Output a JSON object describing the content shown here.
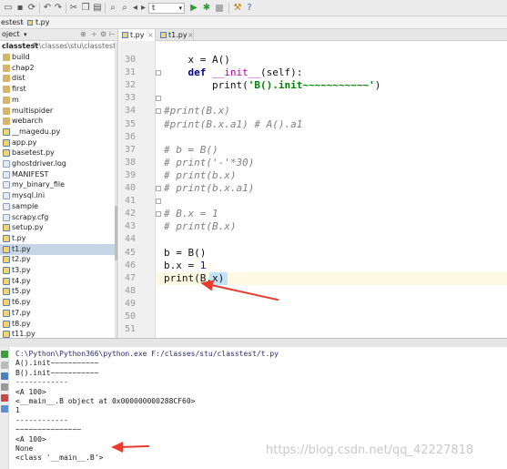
{
  "toolbar": {
    "run_config": "t"
  },
  "navbar": {
    "crumbs": [
      "estest",
      "t.py"
    ]
  },
  "project": {
    "header": "oject",
    "root_label": "classtest",
    "root_path": "F:\\classes\\stu\\classtest",
    "items": [
      {
        "label": "build",
        "kind": "folder"
      },
      {
        "label": "chap2",
        "kind": "folder"
      },
      {
        "label": "dist",
        "kind": "folder"
      },
      {
        "label": "first",
        "kind": "folder"
      },
      {
        "label": "m",
        "kind": "folder"
      },
      {
        "label": "multispider",
        "kind": "folder"
      },
      {
        "label": "webarch",
        "kind": "folder"
      },
      {
        "label": "__magedu.py",
        "kind": "py"
      },
      {
        "label": "app.py",
        "kind": "py"
      },
      {
        "label": "basetest.py",
        "kind": "py"
      },
      {
        "label": "ghostdriver.log",
        "kind": "file"
      },
      {
        "label": "MANIFEST",
        "kind": "file"
      },
      {
        "label": "my_binary_file",
        "kind": "file"
      },
      {
        "label": "mysql.ini",
        "kind": "file"
      },
      {
        "label": "sample",
        "kind": "file"
      },
      {
        "label": "scrapy.cfg",
        "kind": "file"
      },
      {
        "label": "setup.py",
        "kind": "py"
      },
      {
        "label": "t.py",
        "kind": "py"
      },
      {
        "label": "t1.py",
        "kind": "py"
      },
      {
        "label": "t2.py",
        "kind": "py"
      },
      {
        "label": "t3.py",
        "kind": "py"
      },
      {
        "label": "t4.py",
        "kind": "py"
      },
      {
        "label": "t5.py",
        "kind": "py"
      },
      {
        "label": "t6.py",
        "kind": "py"
      },
      {
        "label": "t7.py",
        "kind": "py"
      },
      {
        "label": "t8.py",
        "kind": "py"
      },
      {
        "label": "t11.py",
        "kind": "py"
      }
    ],
    "selected_label": "t1.py"
  },
  "editor": {
    "tabs": [
      {
        "label": "t.py",
        "active": true,
        "close": "×"
      },
      {
        "label": "t1.py",
        "active": false,
        "close": "×"
      }
    ],
    "lines": [
      {
        "no": "30",
        "text": "    x = A()",
        "type": "code"
      },
      {
        "no": "31",
        "text": "    def __init__(self):",
        "type": "def"
      },
      {
        "no": "32",
        "text": "        print('B().init~~~~~~~~~~~')",
        "type": "print"
      },
      {
        "no": "33",
        "text": "",
        "type": "code"
      },
      {
        "no": "34",
        "text": "#print(B.x)",
        "type": "comment"
      },
      {
        "no": "35",
        "text": "#print(B.x.a1) # A().a1",
        "type": "comment"
      },
      {
        "no": "36",
        "text": "",
        "type": "code"
      },
      {
        "no": "37",
        "text": "# b = B()",
        "type": "comment"
      },
      {
        "no": "38",
        "text": "# print('-'*30)",
        "type": "comment"
      },
      {
        "no": "39",
        "text": "# print(b.x)",
        "type": "comment"
      },
      {
        "no": "40",
        "text": "# print(b.x.a1)",
        "type": "comment"
      },
      {
        "no": "41",
        "text": "",
        "type": "code"
      },
      {
        "no": "42",
        "text": "# B.x = 1",
        "type": "comment"
      },
      {
        "no": "43",
        "text": "# print(B.x)",
        "type": "comment"
      },
      {
        "no": "44",
        "text": "",
        "type": "code"
      },
      {
        "no": "45",
        "text": "b = B()",
        "type": "code"
      },
      {
        "no": "46",
        "text": "b.x = 1",
        "type": "assign"
      },
      {
        "no": "47",
        "text": "print(B.x)",
        "type": "current"
      },
      {
        "no": "48",
        "text": "",
        "type": "code"
      },
      {
        "no": "49",
        "text": "",
        "type": "code"
      },
      {
        "no": "50",
        "text": "",
        "type": "code"
      },
      {
        "no": "51",
        "text": "",
        "type": "code"
      }
    ]
  },
  "console": {
    "lines": [
      "C:\\Python\\Python366\\python.exe F:/classes/stu/classtest/t.py",
      "A().init~~~~~~~~~~~",
      "B().init~~~~~~~~~~~",
      "------------",
      "<A 100>",
      "<__main__.B object at 0x000000000288CF60>",
      "1",
      "------------",
      "~~~~~~~~~~~~~~~",
      "<A 100>",
      "None",
      "<class '__main__.B'>"
    ]
  },
  "watermark": "https://blog.csdn.net/qq_42227818",
  "colors": {
    "arrow": "#ea3b2c",
    "selection": "#c7d6e6",
    "current_line": "#fdf9e3"
  }
}
